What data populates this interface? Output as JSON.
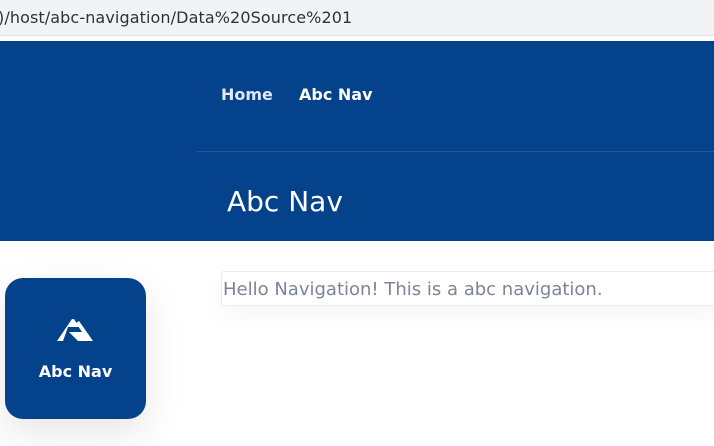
{
  "browser": {
    "url": ")/host/abc-navigation/Data%20Source%201"
  },
  "header": {
    "nav": [
      {
        "label": "Home"
      },
      {
        "label": "Abc Nav"
      }
    ],
    "page_title": "Abc Nav"
  },
  "main": {
    "message": "Hello Navigation! This is a abc navigation."
  },
  "app_tile": {
    "label": "Abc Nav",
    "icon": "abc-nav-logo-icon"
  },
  "colors": {
    "header_bg": "#05428c",
    "tile_bg": "#05428c",
    "text_muted": "#7a8596"
  }
}
